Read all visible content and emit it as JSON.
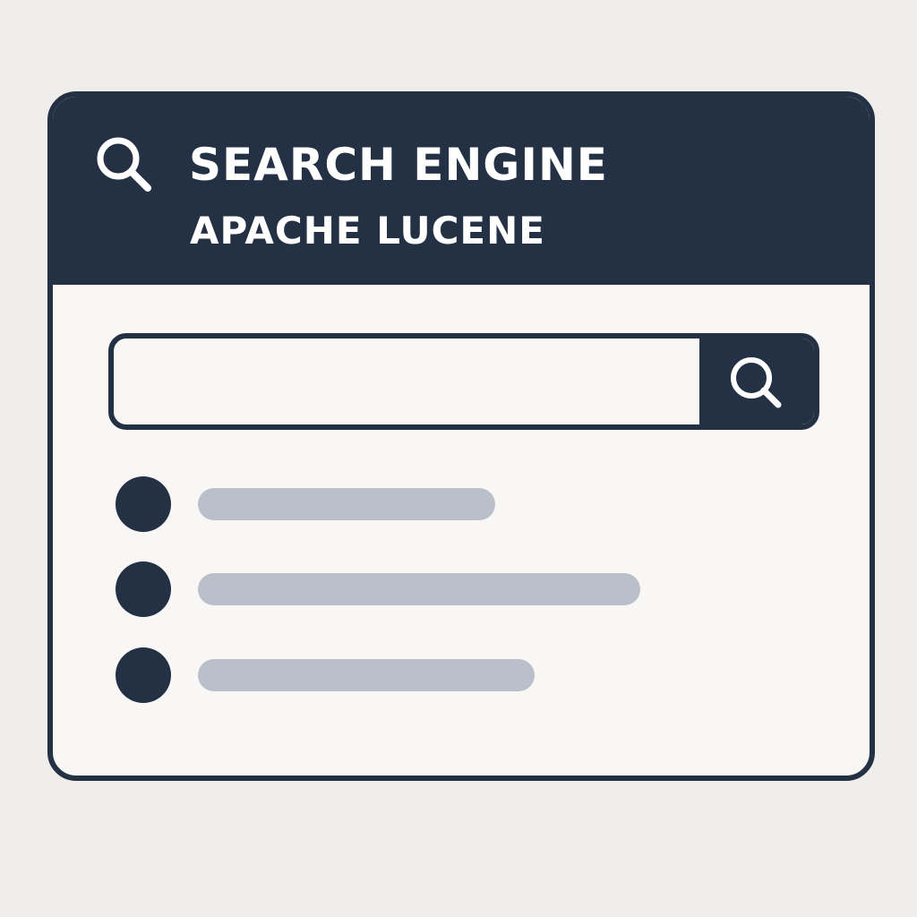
{
  "header": {
    "title": "SEARCH ENGINE",
    "subtitle": "APACHE LUCENE",
    "icon": "search-icon"
  },
  "search": {
    "value": "",
    "placeholder": "",
    "button_icon": "search-icon"
  },
  "results": [
    {
      "bullet": "bullet-dot",
      "text": ""
    },
    {
      "bullet": "bullet-dot",
      "text": ""
    },
    {
      "bullet": "bullet-dot",
      "text": ""
    }
  ],
  "colors": {
    "primary": "#243144",
    "panel": "#f8f7f5",
    "placeholder_line": "#b9c0c9",
    "background": "#efeeec"
  }
}
